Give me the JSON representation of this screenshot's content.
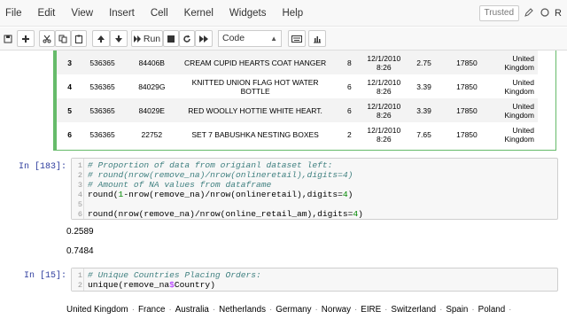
{
  "menu": {
    "items": [
      "File",
      "Edit",
      "View",
      "Insert",
      "Cell",
      "Kernel",
      "Widgets",
      "Help"
    ],
    "trusted": "Trusted",
    "kernel": "R"
  },
  "toolbar": {
    "run_label": "Run",
    "cell_type": "Code",
    "icons": [
      "save-icon",
      "add-cell-icon",
      "cut-icon",
      "copy-icon",
      "paste-icon",
      "move-up-icon",
      "move-down-icon",
      "run-icon",
      "stop-icon",
      "restart-icon",
      "fast-forward-icon",
      "keyboard-icon",
      "chart-icon"
    ]
  },
  "table": {
    "rows": [
      {
        "idx": "3",
        "invoice": "536365",
        "stock": "84406B",
        "desc": "CREAM CUPID HEARTS COAT HANGER",
        "qty": "8",
        "date1": "12/1/2010",
        "date2": "8:26",
        "price": "2.75",
        "cust": "17850",
        "country1": "United",
        "country2": "Kingdom"
      },
      {
        "idx": "4",
        "invoice": "536365",
        "stock": "84029G",
        "desc": "KNITTED UNION FLAG HOT WATER BOTTLE",
        "qty": "6",
        "date1": "12/1/2010",
        "date2": "8:26",
        "price": "3.39",
        "cust": "17850",
        "country1": "United",
        "country2": "Kingdom"
      },
      {
        "idx": "5",
        "invoice": "536365",
        "stock": "84029E",
        "desc": "RED WOOLLY HOTTIE WHITE HEART.",
        "qty": "6",
        "date1": "12/1/2010",
        "date2": "8:26",
        "price": "3.39",
        "cust": "17850",
        "country1": "United",
        "country2": "Kingdom"
      },
      {
        "idx": "6",
        "invoice": "536365",
        "stock": "22752",
        "desc": "SET 7 BABUSHKA NESTING BOXES",
        "qty": "2",
        "date1": "12/1/2010",
        "date2": "8:26",
        "price": "7.65",
        "cust": "17850",
        "country1": "United",
        "country2": "Kingdom"
      }
    ]
  },
  "cell183": {
    "prompt": "In [183]:",
    "line1": "# Proportion of data from origianl dataset left:",
    "line2": "# round(nrow(remove_na)/nrow(onlineretail),digits=4)",
    "line3": "# Amount of NA values from dataframe",
    "line4a": "round(",
    "line4b": "1",
    "line4c": "-nrow(remove_na)/nrow(onlineretail),digits=",
    "line4d": "4",
    "line4e": ")",
    "line6a": "round(nrow(remove_na)/nrow(online_retail_am),digits=",
    "line6b": "4",
    "line6c": ")",
    "out1": "0.2589",
    "out2": "0.7484"
  },
  "cell15": {
    "prompt": "In [15]:",
    "line1": "# Unique Countries Placing Orders:",
    "line2a": "unique(remove_na",
    "line2b": "$",
    "line2c": "Country)"
  },
  "countries": [
    "United Kingdom",
    "France",
    "Australia",
    "Netherlands",
    "Germany",
    "Norway",
    "EIRE",
    "Switzerland",
    "Spain",
    "Poland"
  ]
}
